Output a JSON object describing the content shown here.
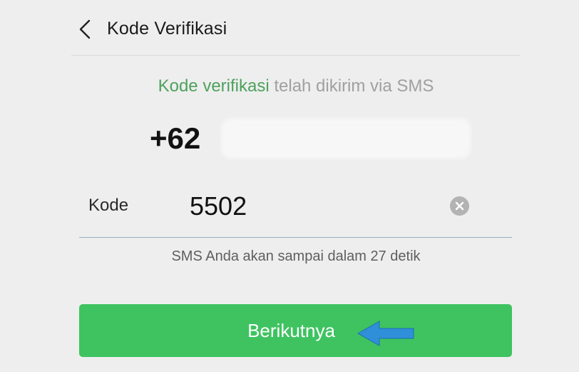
{
  "header": {
    "title": "Kode Verifikasi",
    "back_icon": "chevron-left-icon"
  },
  "message": {
    "highlight": "Kode verifikasi",
    "rest": " telah dikirim via SMS",
    "highlight_color": "#4da15c"
  },
  "phone": {
    "country_code": "+62"
  },
  "code_field": {
    "label": "Kode",
    "value": "5502",
    "clear_icon": "clear-icon"
  },
  "hint": "SMS Anda akan sampai dalam 27 detik",
  "next_button": {
    "label": "Berikutnya",
    "color": "#3ec360"
  },
  "annotation": {
    "icon": "arrow-left-icon",
    "color": "#2f8fd8"
  }
}
